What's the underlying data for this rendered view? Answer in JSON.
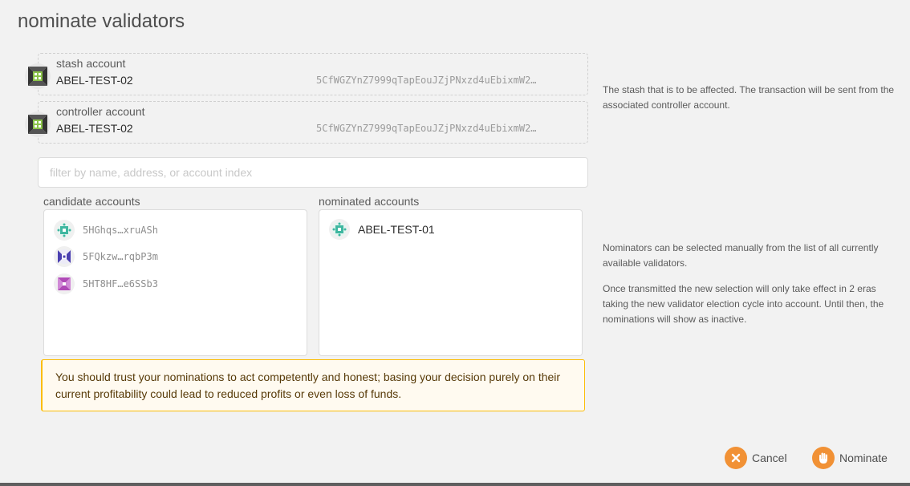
{
  "modal": {
    "title": "nominate validators"
  },
  "stash": {
    "label": "stash account",
    "name": "ABEL-TEST-02",
    "address": "5CfWGZYnZ7999qTapEouJZjPNxzd4uEbixmW2…"
  },
  "controller": {
    "label": "controller account",
    "name": "ABEL-TEST-02",
    "address": "5CfWGZYnZ7999qTapEouJZjPNxzd4uEbixmW2…"
  },
  "help": {
    "stash": "The stash that is to be affected. The transaction will be sent from the associated controller account.",
    "nominators_1": "Nominators can be selected manually from the list of all currently available validators.",
    "nominators_2": "Once transmitted the new selection will only take effect in 2 eras taking the new validator election cycle into account. Until then, the nominations will show as inactive."
  },
  "filter": {
    "placeholder": "filter by name, address, or account index",
    "value": ""
  },
  "candidates": {
    "label": "candidate accounts",
    "items": [
      {
        "address": "5HGhqs…xruASh",
        "icon_color": "#3fb7a0"
      },
      {
        "address": "5FQkzw…rqbP3m",
        "icon_color": "#4a3fb0"
      },
      {
        "address": "5HT8HF…e6SSb3",
        "icon_color": "#b04ab7"
      }
    ]
  },
  "nominated": {
    "label": "nominated accounts",
    "items": [
      {
        "name": "ABEL-TEST-01",
        "icon_color": "#3fb7a0"
      }
    ]
  },
  "warning": {
    "text": "You should trust your nominations to act competently and honest; basing your decision purely on their current profitability could lead to reduced profits or even loss of funds."
  },
  "actions": {
    "cancel_label": "Cancel",
    "nominate_label": "Nominate",
    "cancel_icon": "close-icon",
    "nominate_icon": "hand-icon"
  },
  "colors": {
    "accent": "#f19135",
    "warning_border": "#fbbd08"
  }
}
